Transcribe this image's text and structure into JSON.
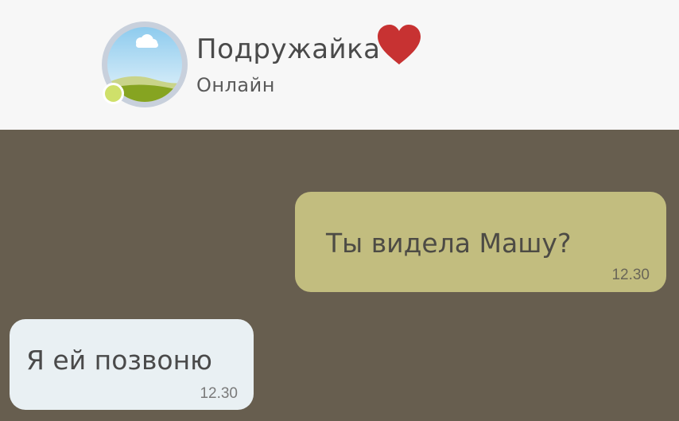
{
  "header": {
    "contact_name": "Подружайка",
    "contact_status": "Онлайн",
    "avatar_icon": "landscape-avatar-icon",
    "status_indicator_icon": "online-dot-icon",
    "heart_icon": "heart-icon",
    "colors": {
      "background": "#f7f7f7",
      "online": "#cfe06a",
      "heart": "#c73232"
    }
  },
  "chat": {
    "background": "#675e4f",
    "messages": [
      {
        "direction": "outgoing",
        "text": "Ты видела Машу?",
        "time": "12.30",
        "color": "#c2bd7f"
      },
      {
        "direction": "incoming",
        "text": "Я ей позвоню",
        "time": "12.30",
        "color": "#e9f0f3"
      }
    ]
  }
}
